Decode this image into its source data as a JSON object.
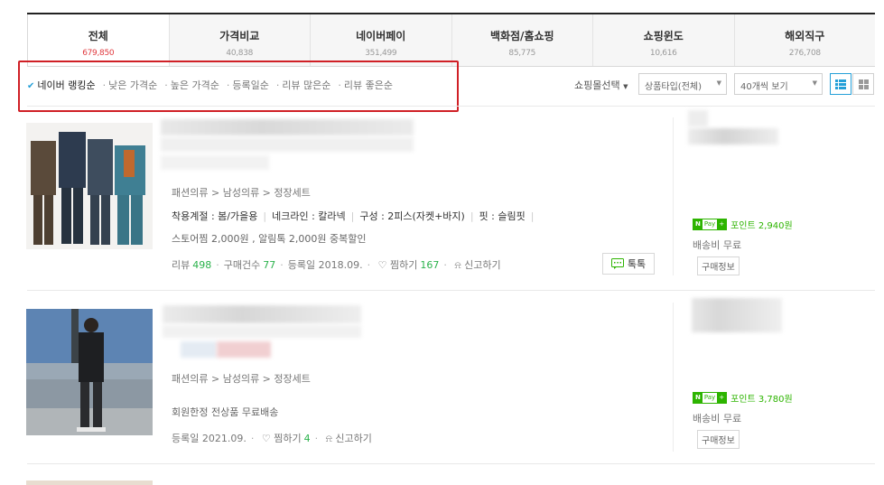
{
  "tabs": [
    {
      "label": "전체",
      "count": "679,850"
    },
    {
      "label": "가격비교",
      "count": "40,838"
    },
    {
      "label": "네이버페이",
      "count": "351,499"
    },
    {
      "label": "백화점/홈쇼핑",
      "count": "85,775"
    },
    {
      "label": "쇼핑윈도",
      "count": "10,616"
    },
    {
      "label": "해외직구",
      "count": "276,708"
    }
  ],
  "sort": {
    "items": [
      "네이버 랭킹순",
      "낮은 가격순",
      "높은 가격순",
      "등록일순",
      "리뷰 많은순",
      "리뷰 좋은순"
    ],
    "mall_select": "쇼핑몰선택",
    "product_type": "상품타입(전체)",
    "per_page": "40개씩 보기"
  },
  "products": [
    {
      "category": [
        "패션의류",
        "남성의류",
        "정장세트"
      ],
      "specs": [
        "착용계절 : 봄/가을용",
        "네크라인 : 칼라넥",
        "구성 : 2피스(자켓+바지)",
        "핏 : 슬림핏"
      ],
      "promo": "스토어찜 2,000원 , 알림톡 2,000원 중복할인",
      "review_label": "리뷰",
      "review_count": "498",
      "purchase_label": "구매건수",
      "purchase_count": "77",
      "reg": "등록일 2018.09.",
      "zzim_label": "찜하기",
      "zzim_count": "167",
      "report": "신고하기",
      "talk": "톡톡",
      "npay_point": "포인트 2,940원",
      "shipping": "배송비 무료",
      "buy_info": "구매정보"
    },
    {
      "category": [
        "패션의류",
        "남성의류",
        "정장세트"
      ],
      "promo": "회원한정 전상품 무료배송",
      "reg": "등록일 2021.09.",
      "zzim_label": "찜하기",
      "zzim_count": "4",
      "report": "신고하기",
      "npay_point": "포인트 3,780원",
      "shipping": "배송비 무료",
      "buy_info": "구매정보"
    }
  ],
  "npay_badge": {
    "n": "N",
    "pay": "Pay",
    "plus": "+"
  },
  "colors": {
    "accent_red": "#e0393e",
    "highlight": "#d02026",
    "green": "#2ab24b",
    "npay": "#2db400",
    "blue": "#25a0d8"
  }
}
